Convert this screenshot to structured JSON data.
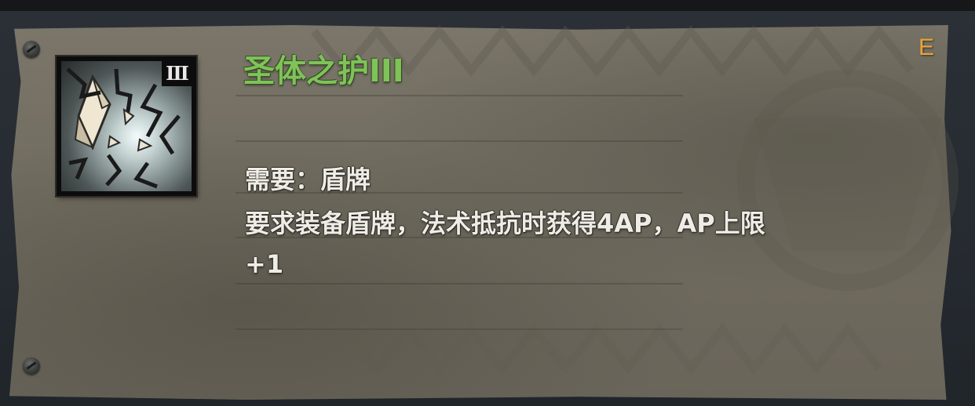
{
  "skill": {
    "title": "圣体之护III",
    "rank_numeral": "III",
    "grade": "E",
    "requirement": "需要：盾牌",
    "description_line1": "要求装备盾牌，法术抵抗时获得4AP，AP上限",
    "description_line2": "+1",
    "icon": "shattered-crystal-shield-icon"
  },
  "colors": {
    "title": "#7fc25a",
    "grade": "#e8a53a",
    "text": "#efece6",
    "parchment": "#716c60",
    "frame": "#262b31"
  }
}
